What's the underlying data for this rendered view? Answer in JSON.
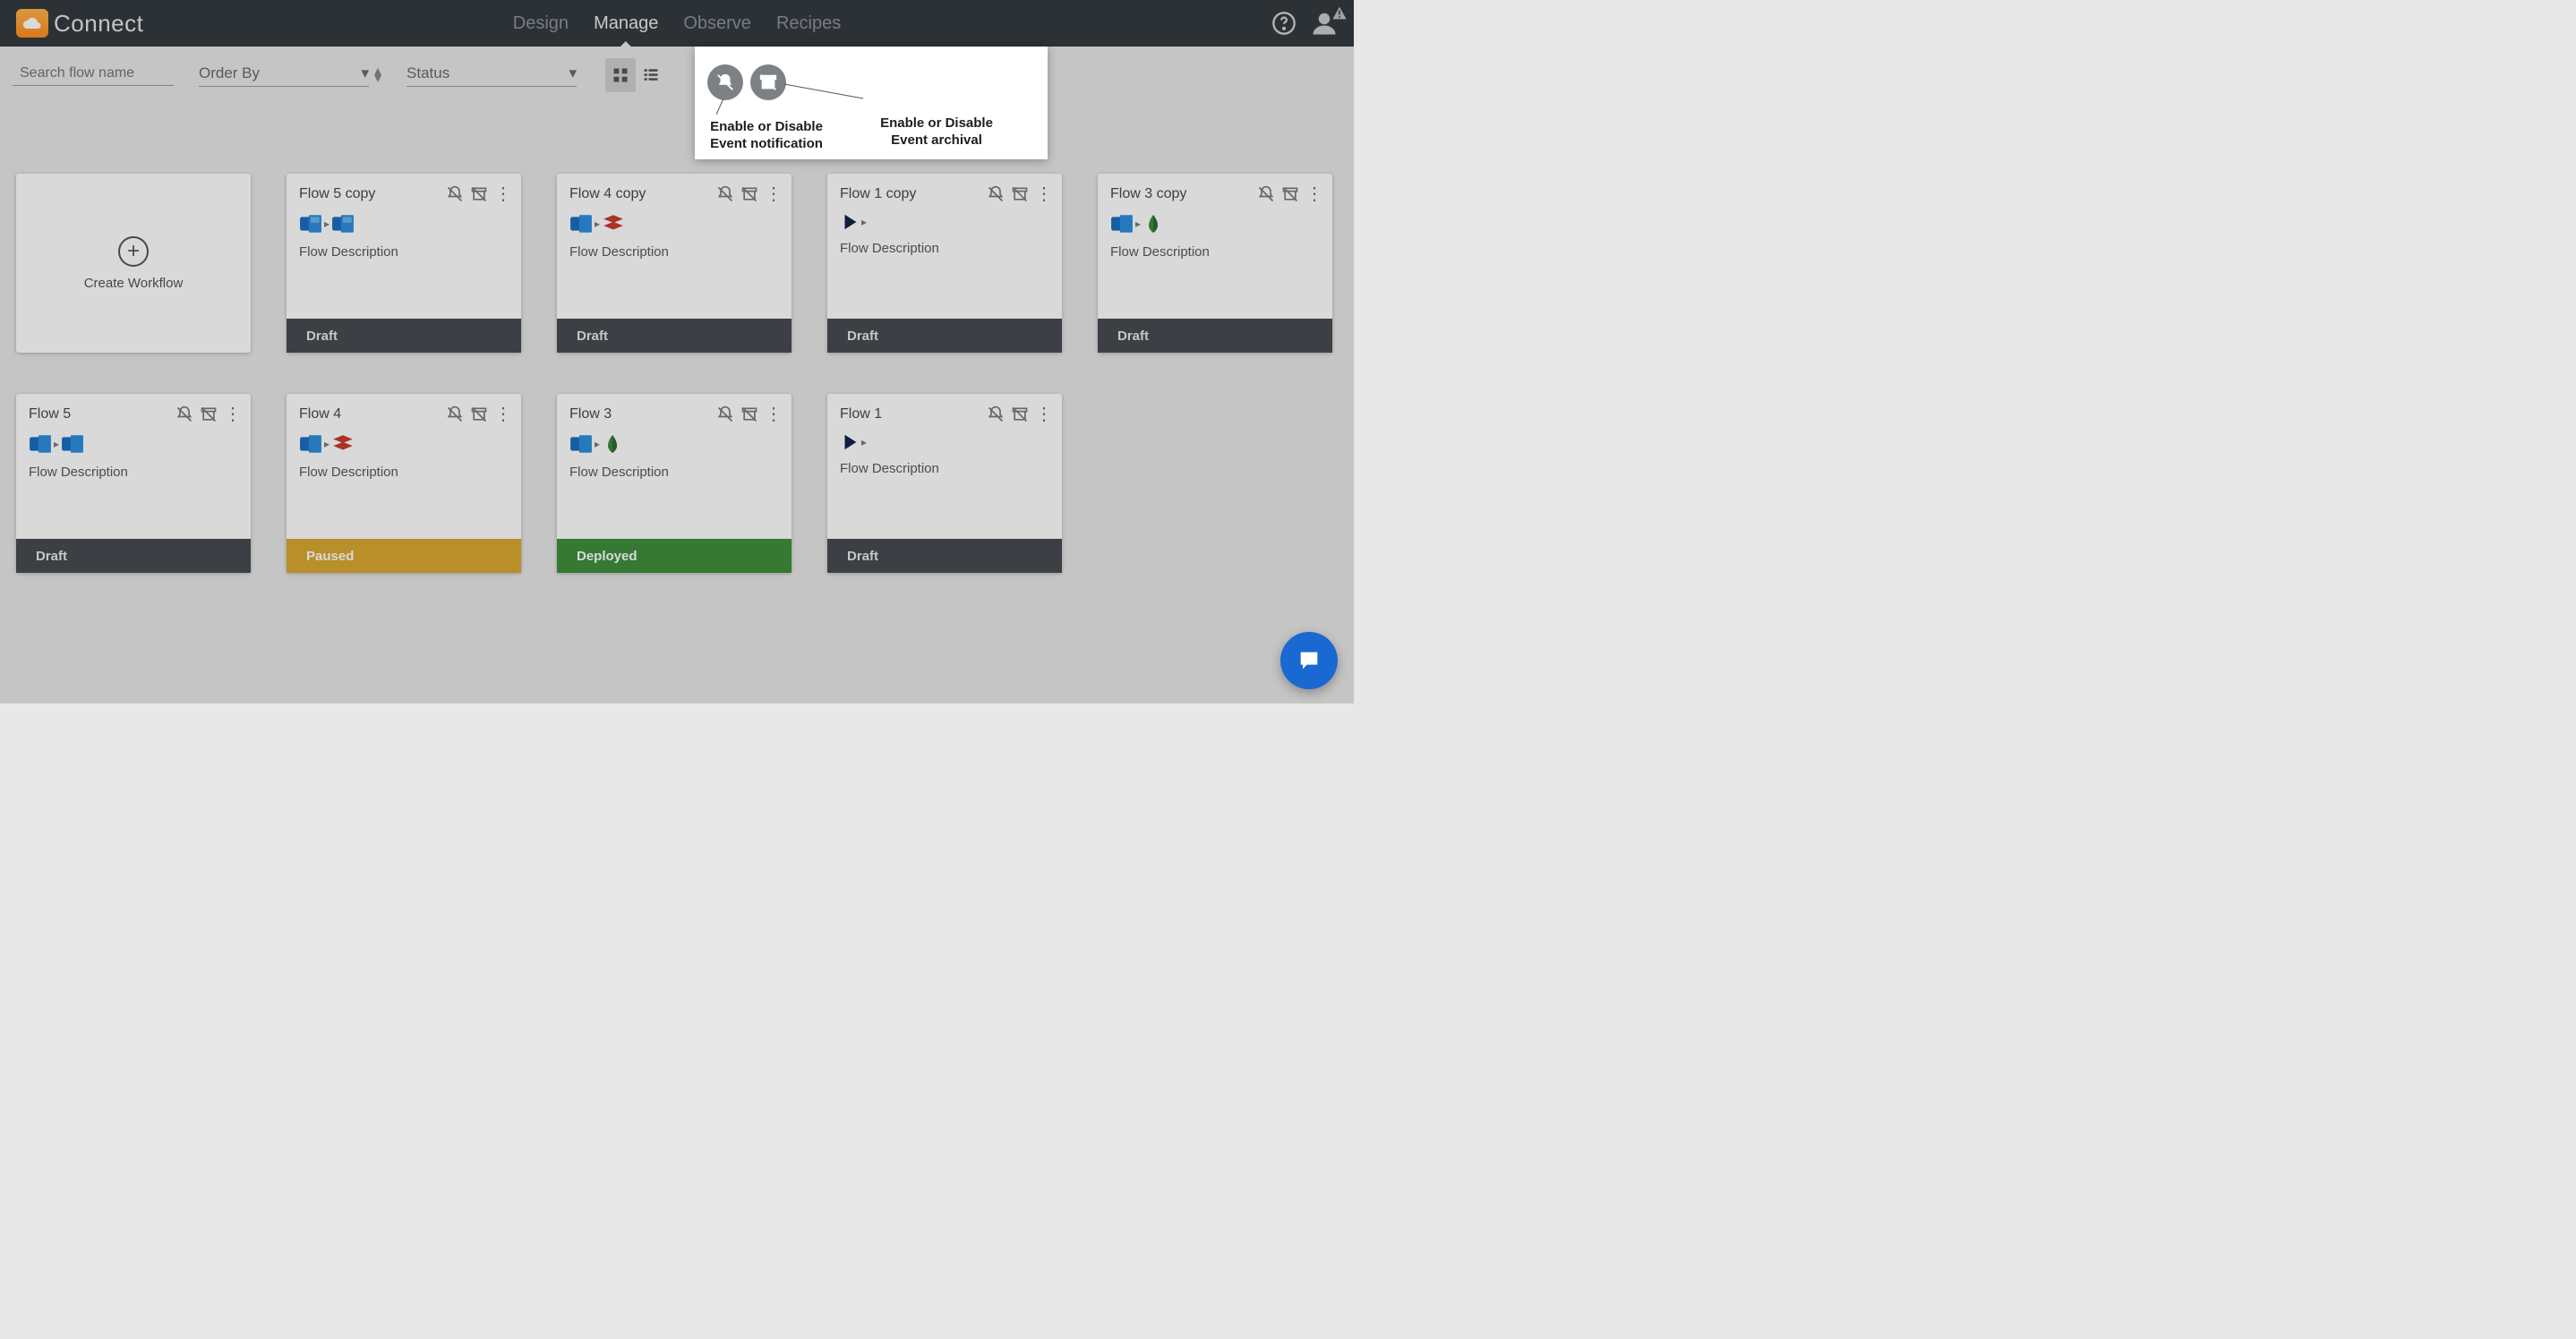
{
  "brand": "Connect",
  "nav": {
    "tabs": [
      "Design",
      "Manage",
      "Observe",
      "Recipes"
    ],
    "active_index": 1
  },
  "filters": {
    "search_placeholder": "Search flow name",
    "order_by_label": "Order By",
    "status_label": "Status"
  },
  "create_label": "Create Workflow",
  "callout": {
    "notif_text": "Enable or Disable Event notification",
    "archive_text": "Enable or Disable Event archival"
  },
  "cards": [
    {
      "title": "Flow 5 copy",
      "desc": "Flow Description",
      "status": "Draft",
      "status_class": "draft",
      "icons": [
        "outlook",
        "outlook"
      ]
    },
    {
      "title": "Flow 4 copy",
      "desc": "Flow Description",
      "status": "Draft",
      "status_class": "draft",
      "icons": [
        "outlook",
        "redis"
      ]
    },
    {
      "title": "Flow 1 copy",
      "desc": "Flow Description",
      "status": "Draft",
      "status_class": "draft",
      "icons": [
        "play"
      ]
    },
    {
      "title": "Flow 3 copy",
      "desc": "Flow Description",
      "status": "Draft",
      "status_class": "draft",
      "icons": [
        "outlook",
        "mongo"
      ]
    },
    {
      "title": "Flow 5",
      "desc": "Flow Description",
      "status": "Draft",
      "status_class": "draft",
      "icons": [
        "outlook",
        "outlook"
      ]
    },
    {
      "title": "Flow 4",
      "desc": "Flow Description",
      "status": "Paused",
      "status_class": "paused",
      "icons": [
        "outlook",
        "redis"
      ]
    },
    {
      "title": "Flow 3",
      "desc": "Flow Description",
      "status": "Deployed",
      "status_class": "deployed",
      "icons": [
        "outlook",
        "mongo"
      ]
    },
    {
      "title": "Flow 1",
      "desc": "Flow Description",
      "status": "Draft",
      "status_class": "draft",
      "icons": [
        "play"
      ]
    }
  ]
}
